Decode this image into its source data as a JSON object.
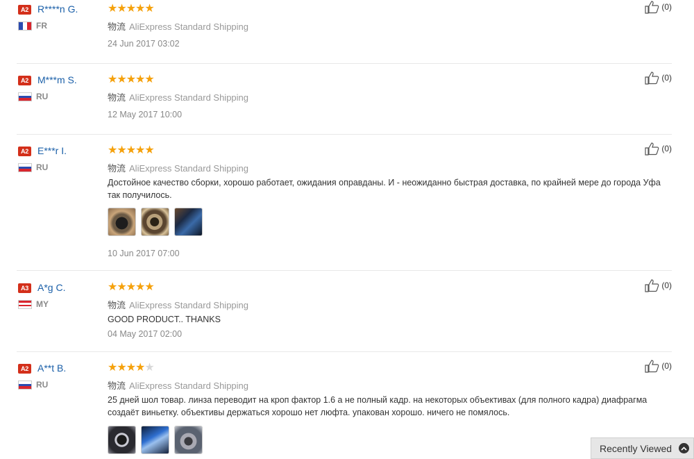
{
  "reviews": [
    {
      "badge": "A2",
      "name": "R****n G.",
      "country": "FR",
      "rating": 5,
      "stars": "★★★★★",
      "stars_off": "",
      "shipping_cn": "物流",
      "shipping": "AliExpress Standard Shipping",
      "text": "",
      "date": "24 Jun 2017 03:02",
      "helpful": "(0)"
    },
    {
      "badge": "A2",
      "name": "M***m S.",
      "country": "RU",
      "rating": 5,
      "stars": "★★★★★",
      "stars_off": "",
      "shipping_cn": "物流",
      "shipping": "AliExpress Standard Shipping",
      "text": "",
      "date": "12 May 2017 10:00",
      "helpful": "(0)"
    },
    {
      "badge": "A2",
      "name": "E***r I.",
      "country": "RU",
      "rating": 5,
      "stars": "★★★★★",
      "stars_off": "",
      "shipping_cn": "物流",
      "shipping": "AliExpress Standard Shipping",
      "text": "Достойное качество сборки, хорошо работает, ожидания оправданы. И - неожиданно быстрая доставка, по крайней мере до города Уфа так получилось.",
      "date": "10 Jun 2017 07:00",
      "helpful": "(0)"
    },
    {
      "badge": "A3",
      "name": "A*g C.",
      "country": "MY",
      "rating": 5,
      "stars": "★★★★★",
      "stars_off": "",
      "shipping_cn": "物流",
      "shipping": "AliExpress Standard Shipping",
      "text": "GOOD PRODUCT.. THANKS",
      "date": "04 May 2017 02:00",
      "helpful": "(0)"
    },
    {
      "badge": "A2",
      "name": "A**t B.",
      "country": "RU",
      "rating": 4,
      "stars": "★★★★",
      "stars_off": "★",
      "shipping_cn": "物流",
      "shipping": "AliExpress Standard Shipping",
      "text": "25 дней шол товар. линза переводит на кроп фактор 1.6 а не полный кадр. на некоторых объективах (для полного кадра) диафрагма создаёт виньетку. объективы держаться хорошо нет люфта. упакован хорошо. ничего не помялось.",
      "date": "",
      "helpful": "(0)"
    }
  ],
  "recently_viewed": "Recently Viewed",
  "colors": {
    "badge": "#d32f1a",
    "name": "#1a5fa8",
    "star": "#f5a10c",
    "star_off": "#d8d8d8"
  },
  "icons": {
    "helpful": "thumbs-up-icon",
    "recent": "chevron-up-icon"
  }
}
